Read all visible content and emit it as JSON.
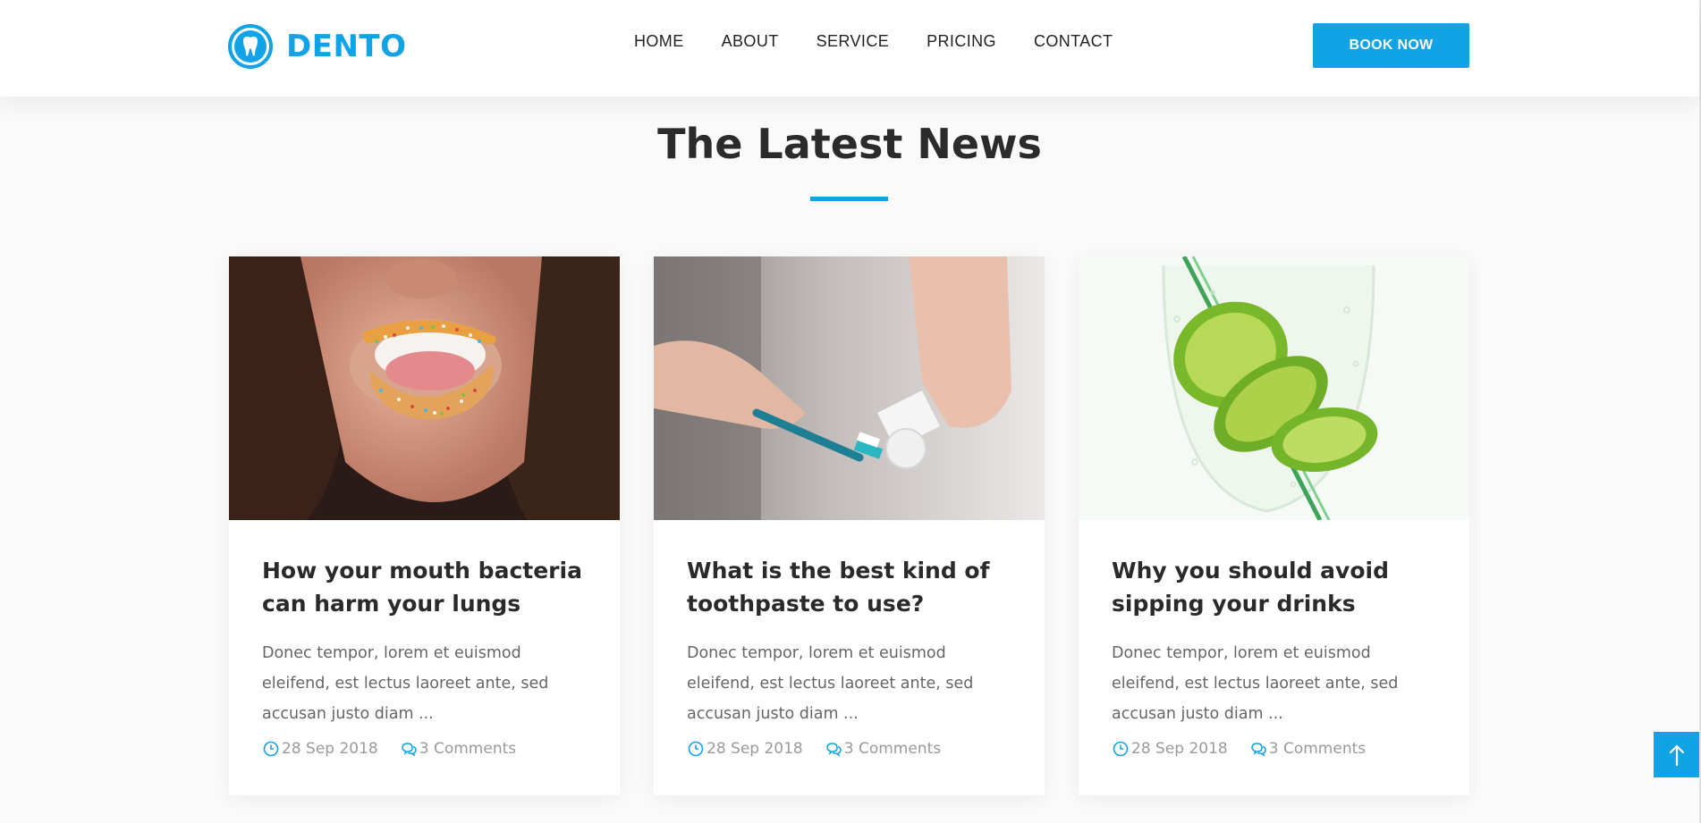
{
  "colors": {
    "accent": "#11a3e6",
    "heading": "#2b2b2b",
    "body_text": "#666666",
    "meta_text": "#9a9a9a"
  },
  "header": {
    "logo_text": "DENTO",
    "logo_icon": "tooth-icon",
    "nav": [
      "HOME",
      "ABOUT",
      "SERVICE",
      "PRICING",
      "CONTACT"
    ],
    "cta_label": "BOOK NOW"
  },
  "section": {
    "title": "The Latest News"
  },
  "posts": [
    {
      "title": "How your mouth bacteria can harm your lungs",
      "excerpt": "Donec tempor, lorem et euismod eleifend, est lectus laoreet ante, sed accusan justo diam ...",
      "date": "28 Sep 2018",
      "comments": "3 Comments",
      "image": "woman-sprinkles-lips-photo"
    },
    {
      "title": "What is the best kind of toothpaste to use?",
      "excerpt": "Donec tempor, lorem et euismod eleifend, est lectus laoreet ante, sed accusan justo diam ...",
      "date": "28 Sep 2018",
      "comments": "3 Comments",
      "image": "toothbrush-toothpaste-photo"
    },
    {
      "title": "Why you should avoid sipping your drinks",
      "excerpt": "Donec tempor, lorem et euismod eleifend, est lectus laoreet ante, sed accusan justo diam ...",
      "date": "28 Sep 2018",
      "comments": "3 Comments",
      "image": "lime-glass-straw-photo"
    }
  ],
  "scroll_top_icon": "arrow-up-icon"
}
